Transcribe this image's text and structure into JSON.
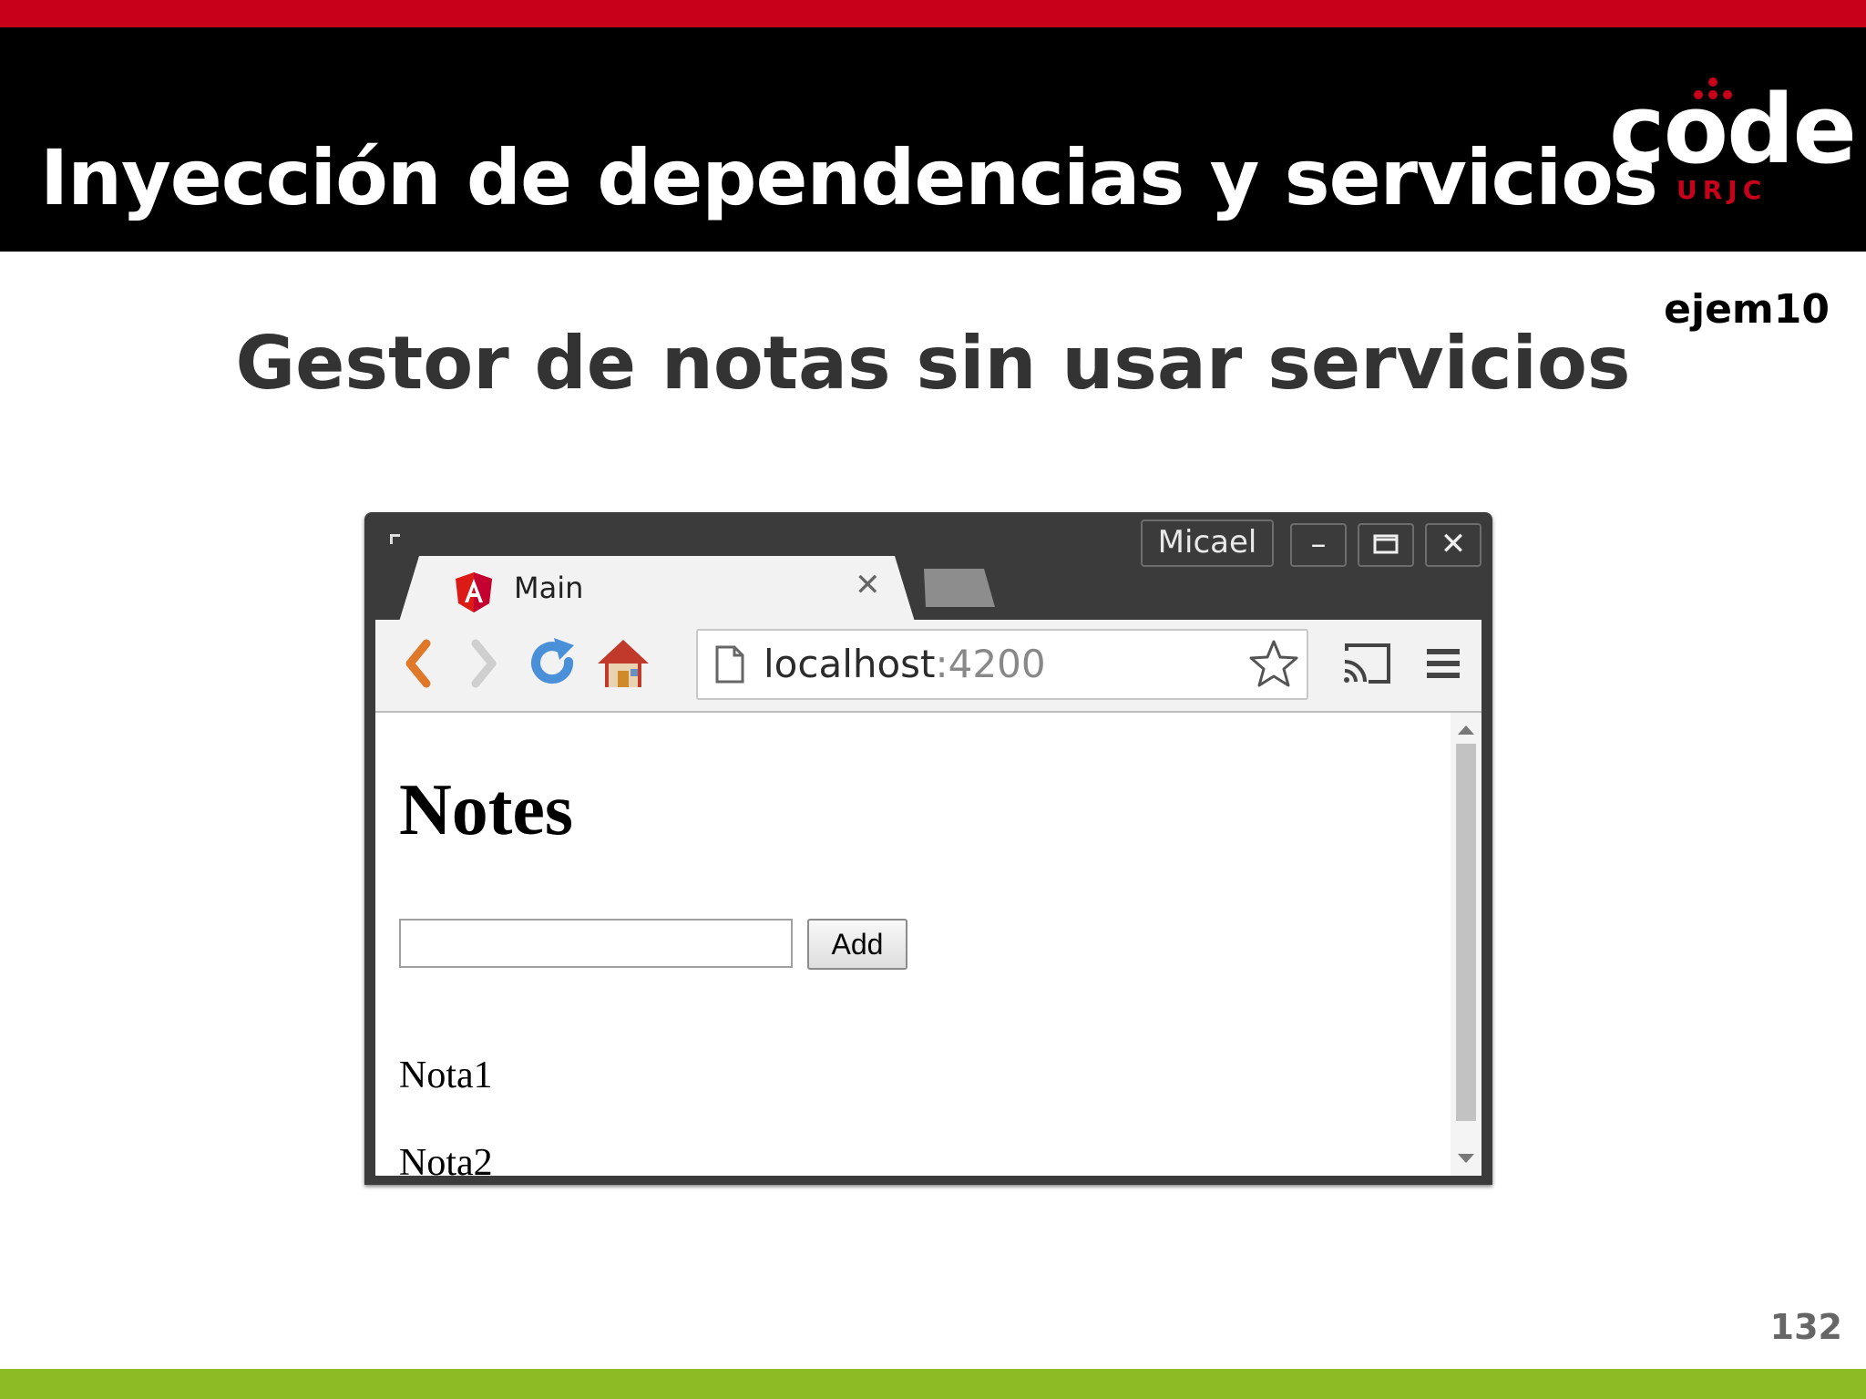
{
  "slide": {
    "title": "Inyección de dependencias y servicios",
    "subtitle": "Gestor de notas sin usar servicios",
    "example_tag": "ejem10",
    "page_number": "132",
    "logo_word": "code",
    "logo_sub": "URJC"
  },
  "browser": {
    "profile_name": "Micael",
    "window_buttons": {
      "minimize": "–",
      "maximize": "☐",
      "close": "✕"
    },
    "tab": {
      "label": "Main",
      "close": "✕"
    },
    "address": {
      "host": "localhost",
      "port": ":4200"
    }
  },
  "page": {
    "heading": "Notes",
    "input_value": "",
    "add_label": "Add",
    "notes": [
      "Nota1",
      "Nota2"
    ]
  },
  "colors": {
    "header_bg": "#000000",
    "brand_red": "#c8001a",
    "footer_green": "#8dbb25"
  }
}
